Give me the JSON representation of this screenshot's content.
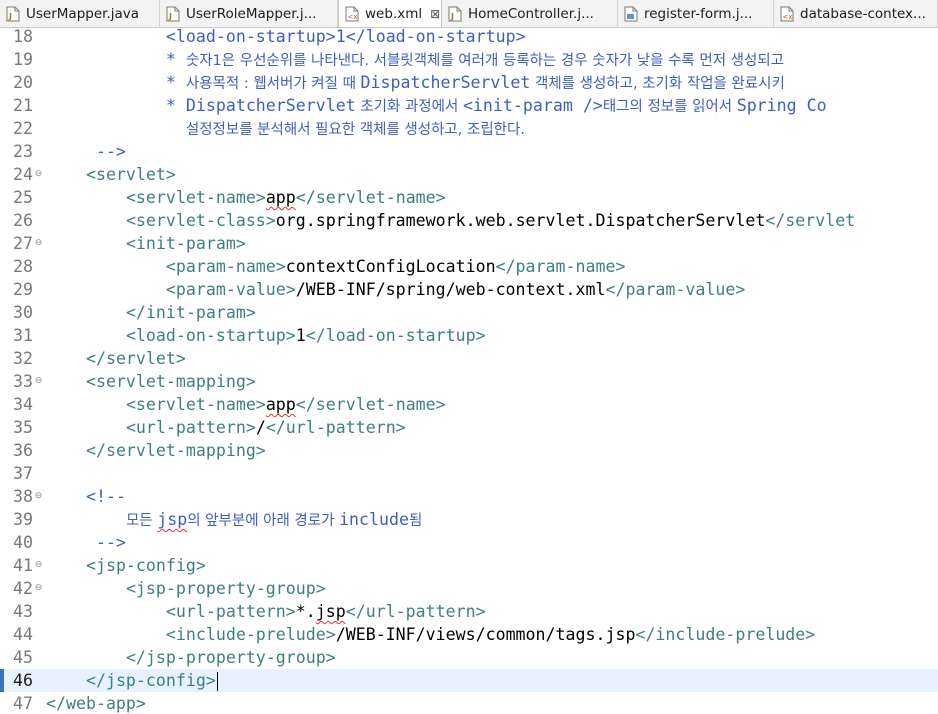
{
  "tabs": [
    {
      "label": "UserMapper.java",
      "icon": "java-file-icon",
      "active": false
    },
    {
      "label": "UserRoleMapper.j...",
      "icon": "java-file-icon",
      "active": false
    },
    {
      "label": "web.xml",
      "icon": "xml-file-icon",
      "active": true,
      "close": "⊠"
    },
    {
      "label": "HomeController.j...",
      "icon": "java-file-icon",
      "active": false
    },
    {
      "label": "register-form.j...",
      "icon": "jsp-file-icon",
      "active": false
    },
    {
      "label": "database-contex...",
      "icon": "xml-file-icon",
      "active": false
    }
  ],
  "editor": {
    "current_line": 46,
    "lines": [
      {
        "n": "18",
        "fold": "",
        "segs": [
          {
            "t": "            ",
            "c": "txt"
          },
          {
            "t": "<load-on-startup>",
            "c": "cmt"
          },
          {
            "t": "1",
            "c": "cmt"
          },
          {
            "t": "</load-on-startup>",
            "c": "cmt"
          }
        ]
      },
      {
        "n": "19",
        "fold": "",
        "segs": [
          {
            "t": "            * ",
            "c": "cmt"
          },
          {
            "t": "숫자1은 우선순위를 나타낸다. 서블릿객체를 여러개 등록하는 경우 숫자가 낮을 수록 먼저 생성되고",
            "c": "cmt ko"
          }
        ]
      },
      {
        "n": "20",
        "fold": "",
        "segs": [
          {
            "t": "            * ",
            "c": "cmt"
          },
          {
            "t": "사용목적 : 웹서버가 켜질 때 ",
            "c": "cmt ko"
          },
          {
            "t": "DispatcherServlet",
            "c": "cmt"
          },
          {
            "t": " 객체를 생성하고, 초기화 작업을 완료시키",
            "c": "cmt ko"
          }
        ]
      },
      {
        "n": "21",
        "fold": "",
        "segs": [
          {
            "t": "            * ",
            "c": "cmt"
          },
          {
            "t": "DispatcherServlet",
            "c": "cmt"
          },
          {
            "t": " 초기화 과정에서 ",
            "c": "cmt ko"
          },
          {
            "t": "<init-param />",
            "c": "cmt"
          },
          {
            "t": "태그의 정보를 읽어서 ",
            "c": "cmt ko"
          },
          {
            "t": "Spring Co",
            "c": "cmt"
          }
        ]
      },
      {
        "n": "22",
        "fold": "",
        "segs": [
          {
            "t": "              ",
            "c": "cmt"
          },
          {
            "t": "설정정보를 분석해서 필요한 객체를 생성하고, 조립한다.",
            "c": "cmt ko"
          }
        ]
      },
      {
        "n": "23",
        "fold": "",
        "segs": [
          {
            "t": "     -->",
            "c": "cmt"
          }
        ]
      },
      {
        "n": "24",
        "fold": "⊖",
        "segs": [
          {
            "t": "    ",
            "c": "txt"
          },
          {
            "t": "<servlet>",
            "c": "tag"
          }
        ]
      },
      {
        "n": "25",
        "fold": "",
        "segs": [
          {
            "t": "        ",
            "c": "txt"
          },
          {
            "t": "<servlet-name>",
            "c": "tag"
          },
          {
            "t": "app",
            "c": "txt squiggle"
          },
          {
            "t": "</servlet-name>",
            "c": "tag"
          }
        ]
      },
      {
        "n": "26",
        "fold": "",
        "segs": [
          {
            "t": "        ",
            "c": "txt"
          },
          {
            "t": "<servlet-class>",
            "c": "tag"
          },
          {
            "t": "org.springframework.web.servlet.DispatcherServlet",
            "c": "txt"
          },
          {
            "t": "</servlet",
            "c": "tag"
          }
        ]
      },
      {
        "n": "27",
        "fold": "⊖",
        "segs": [
          {
            "t": "        ",
            "c": "txt"
          },
          {
            "t": "<init-param>",
            "c": "tag"
          }
        ]
      },
      {
        "n": "28",
        "fold": "",
        "segs": [
          {
            "t": "            ",
            "c": "txt"
          },
          {
            "t": "<param-name>",
            "c": "tag"
          },
          {
            "t": "contextConfigLocation",
            "c": "txt"
          },
          {
            "t": "</param-name>",
            "c": "tag"
          }
        ]
      },
      {
        "n": "29",
        "fold": "",
        "segs": [
          {
            "t": "            ",
            "c": "txt"
          },
          {
            "t": "<param-value>",
            "c": "tag"
          },
          {
            "t": "/WEB-INF/spring/web-context.xml",
            "c": "txt"
          },
          {
            "t": "</param-value>",
            "c": "tag"
          }
        ]
      },
      {
        "n": "30",
        "fold": "",
        "segs": [
          {
            "t": "        ",
            "c": "txt"
          },
          {
            "t": "</init-param>",
            "c": "tag"
          }
        ]
      },
      {
        "n": "31",
        "fold": "",
        "segs": [
          {
            "t": "        ",
            "c": "txt"
          },
          {
            "t": "<load-on-startup>",
            "c": "tag"
          },
          {
            "t": "1",
            "c": "txt"
          },
          {
            "t": "</load-on-startup>",
            "c": "tag"
          }
        ]
      },
      {
        "n": "32",
        "fold": "",
        "segs": [
          {
            "t": "    ",
            "c": "txt"
          },
          {
            "t": "</servlet>",
            "c": "tag"
          }
        ]
      },
      {
        "n": "33",
        "fold": "⊖",
        "segs": [
          {
            "t": "    ",
            "c": "txt"
          },
          {
            "t": "<servlet-mapping>",
            "c": "tag"
          }
        ]
      },
      {
        "n": "34",
        "fold": "",
        "segs": [
          {
            "t": "        ",
            "c": "txt"
          },
          {
            "t": "<servlet-name>",
            "c": "tag"
          },
          {
            "t": "app",
            "c": "txt squiggle"
          },
          {
            "t": "</servlet-name>",
            "c": "tag"
          }
        ]
      },
      {
        "n": "35",
        "fold": "",
        "segs": [
          {
            "t": "        ",
            "c": "txt"
          },
          {
            "t": "<url-pattern>",
            "c": "tag"
          },
          {
            "t": "/",
            "c": "txt"
          },
          {
            "t": "</url-pattern>",
            "c": "tag"
          }
        ]
      },
      {
        "n": "36",
        "fold": "",
        "segs": [
          {
            "t": "    ",
            "c": "txt"
          },
          {
            "t": "</servlet-mapping>",
            "c": "tag"
          }
        ]
      },
      {
        "n": "37",
        "fold": "",
        "segs": []
      },
      {
        "n": "38",
        "fold": "⊖",
        "segs": [
          {
            "t": "    ",
            "c": "txt"
          },
          {
            "t": "<!--",
            "c": "cmt"
          }
        ]
      },
      {
        "n": "39",
        "fold": "",
        "segs": [
          {
            "t": "        ",
            "c": "cmt"
          },
          {
            "t": "모든 ",
            "c": "cmt ko"
          },
          {
            "t": "jsp",
            "c": "cmt squiggle"
          },
          {
            "t": "의 앞부분에 아래 경로가 ",
            "c": "cmt ko"
          },
          {
            "t": "include",
            "c": "cmt"
          },
          {
            "t": "됨",
            "c": "cmt ko"
          }
        ]
      },
      {
        "n": "40",
        "fold": "",
        "segs": [
          {
            "t": "     -->",
            "c": "cmt"
          }
        ]
      },
      {
        "n": "41",
        "fold": "⊖",
        "segs": [
          {
            "t": "    ",
            "c": "txt"
          },
          {
            "t": "<jsp-config>",
            "c": "tag"
          }
        ]
      },
      {
        "n": "42",
        "fold": "⊖",
        "segs": [
          {
            "t": "        ",
            "c": "txt"
          },
          {
            "t": "<jsp-property-group>",
            "c": "tag"
          }
        ]
      },
      {
        "n": "43",
        "fold": "",
        "segs": [
          {
            "t": "            ",
            "c": "txt"
          },
          {
            "t": "<url-pattern>",
            "c": "tag"
          },
          {
            "t": "*.",
            "c": "txt"
          },
          {
            "t": "jsp",
            "c": "txt squiggle"
          },
          {
            "t": "</url-pattern>",
            "c": "tag"
          }
        ]
      },
      {
        "n": "44",
        "fold": "",
        "segs": [
          {
            "t": "            ",
            "c": "txt"
          },
          {
            "t": "<include-prelude>",
            "c": "tag"
          },
          {
            "t": "/WEB-INF/views/common/tags.jsp",
            "c": "txt"
          },
          {
            "t": "</include-prelude>",
            "c": "tag"
          }
        ]
      },
      {
        "n": "45",
        "fold": "",
        "segs": [
          {
            "t": "        ",
            "c": "txt"
          },
          {
            "t": "</jsp-property-group>",
            "c": "tag"
          }
        ]
      },
      {
        "n": "46",
        "fold": "",
        "segs": [
          {
            "t": "    ",
            "c": "txt"
          },
          {
            "t": "</jsp-config>",
            "c": "tag"
          }
        ]
      },
      {
        "n": "47",
        "fold": "",
        "segs": [
          {
            "t": "</web-app>",
            "c": "tag"
          }
        ]
      }
    ]
  },
  "colors": {
    "tag": "#3f7f7f",
    "comment": "#3f5fbf",
    "text": "#000000",
    "line_number": "#787878",
    "current_line_bg": "#e8f2fe"
  }
}
